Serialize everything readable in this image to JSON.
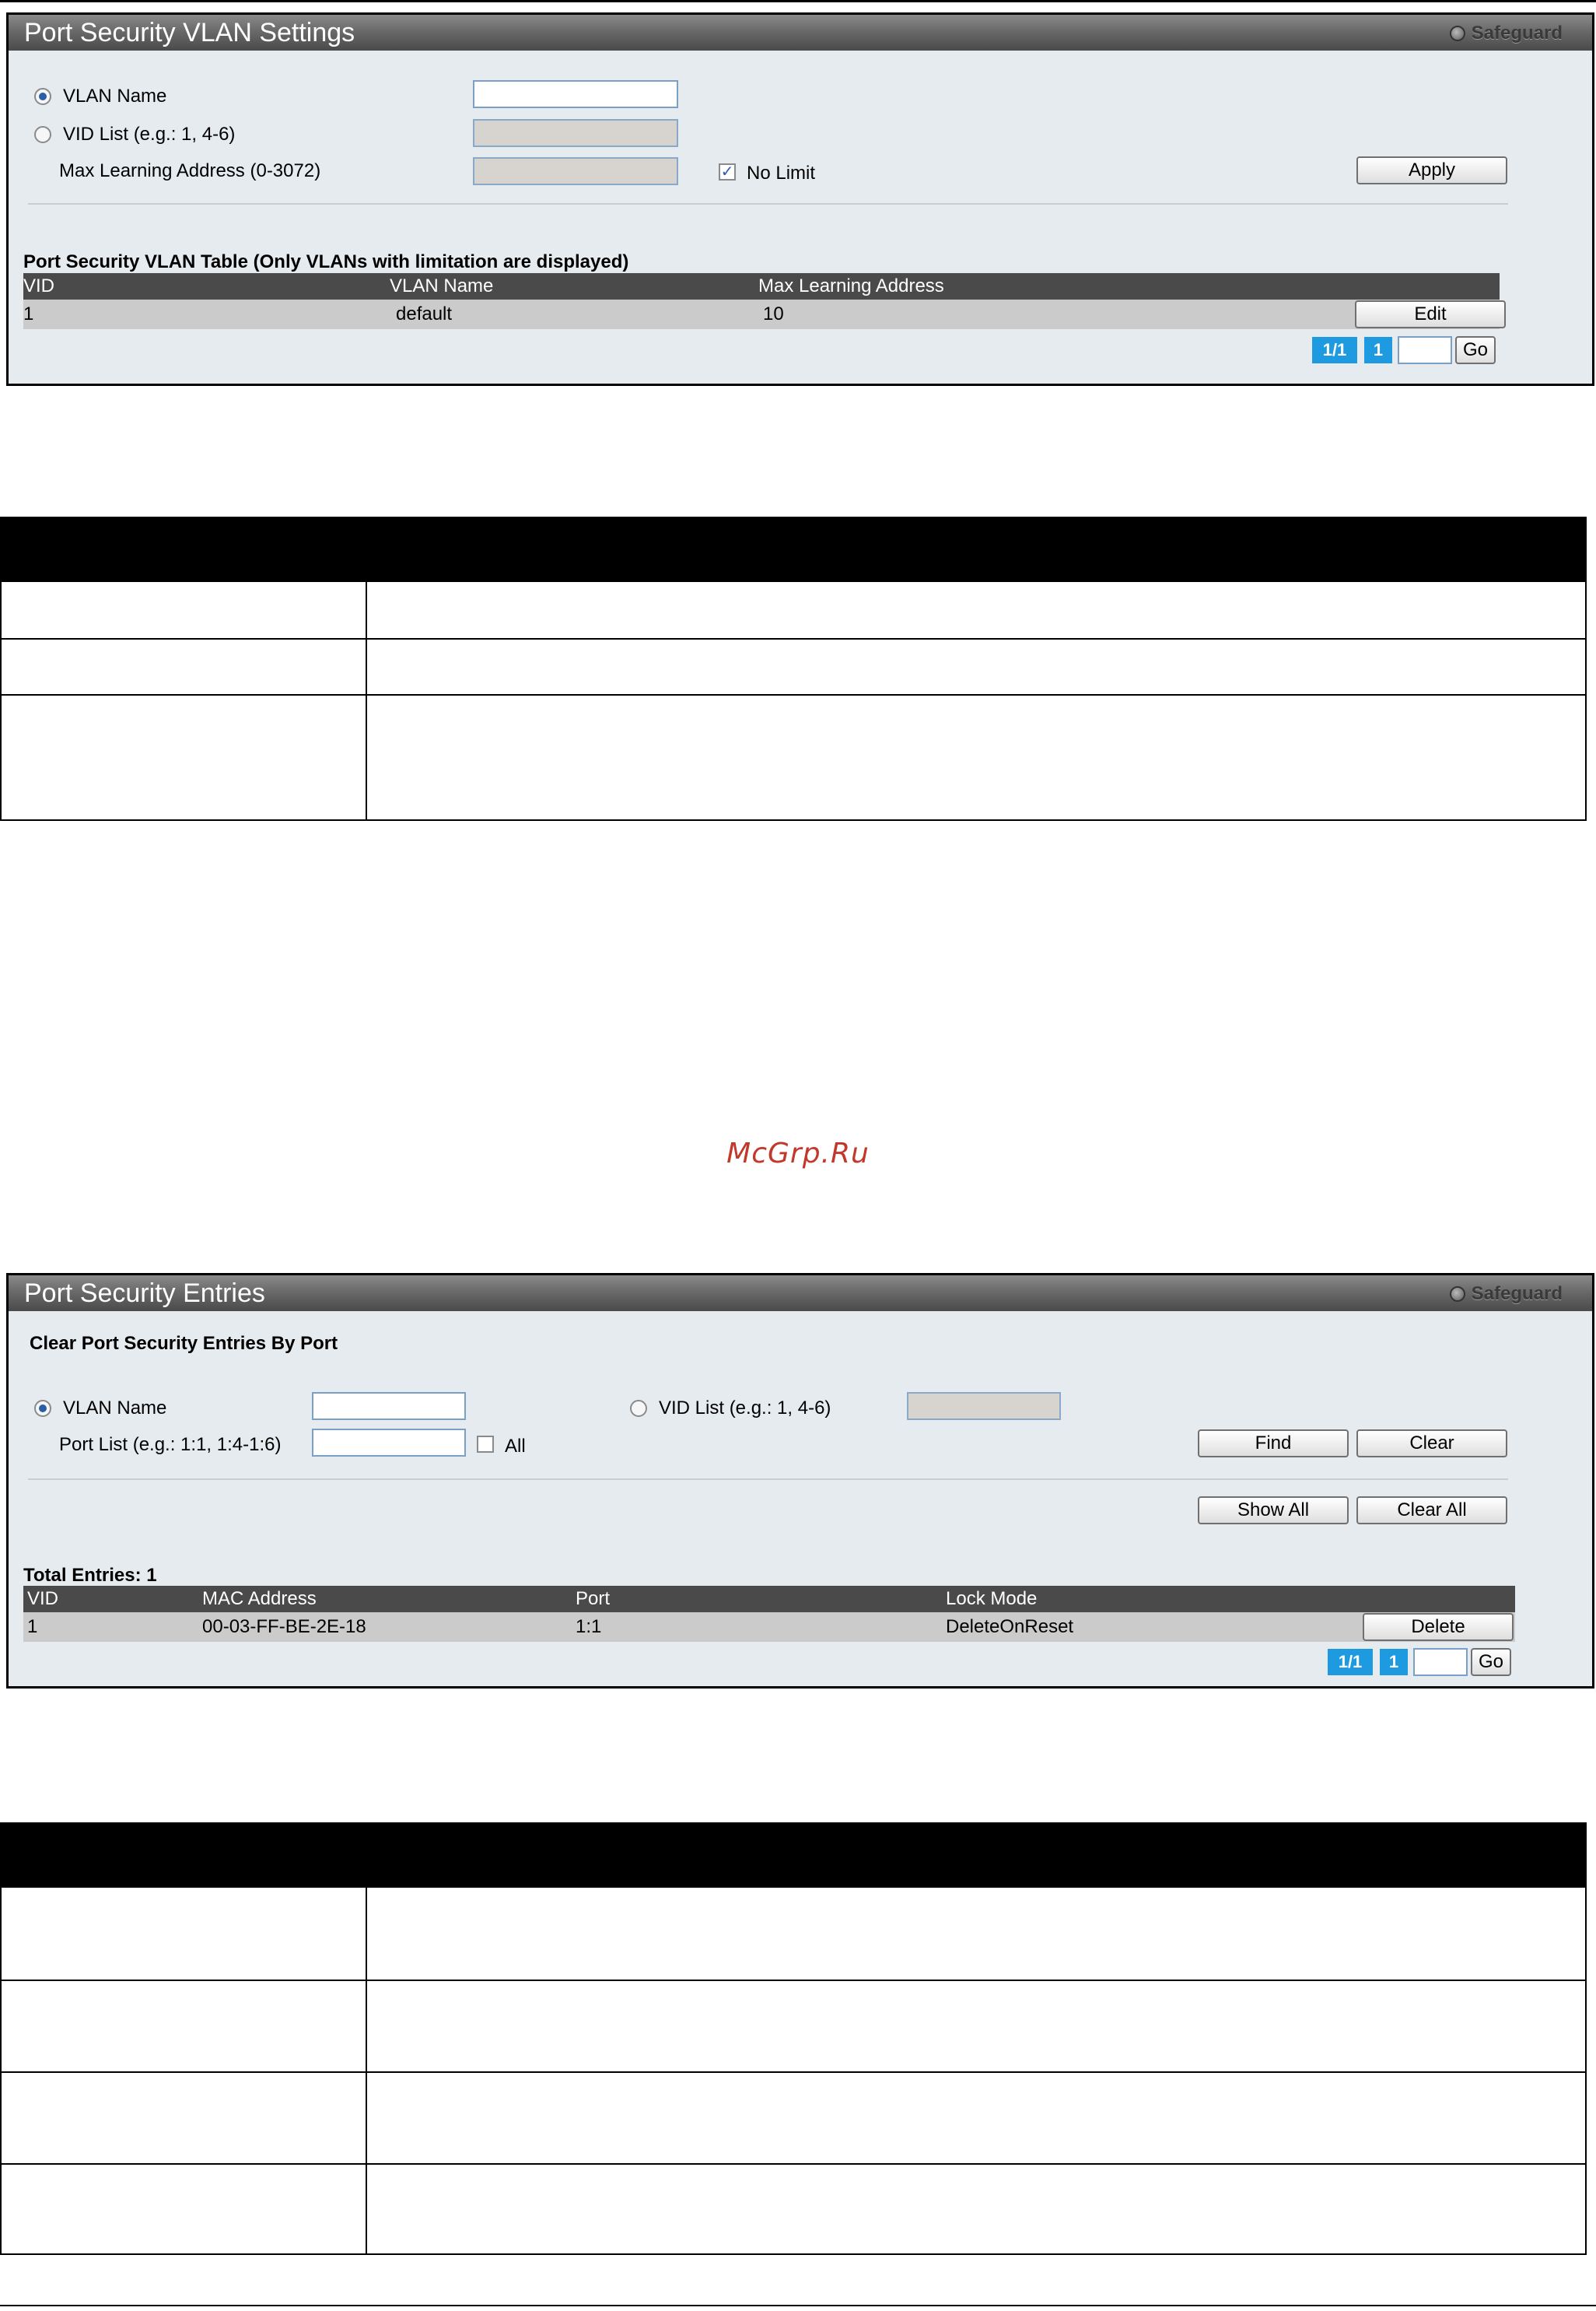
{
  "vlan_settings": {
    "title": "Port Security VLAN Settings",
    "safeguard": "Safeguard",
    "vlan_name_label": "VLAN Name",
    "vid_list_label": "VID List (e.g.: 1, 4-6)",
    "max_learning_label": "Max Learning Address (0-3072)",
    "no_limit_label": "No Limit",
    "no_limit_checked": true,
    "vlan_name_value": "",
    "apply_label": "Apply",
    "table_title": "Port Security VLAN Table (Only VLANs with limitation are displayed)",
    "columns": [
      "VID",
      "VLAN Name",
      "Max Learning Address"
    ],
    "rows": [
      {
        "vid": "1",
        "vlan_name": "default",
        "max_learning": "10",
        "action": "Edit"
      }
    ],
    "pager": {
      "pages": "1/1",
      "current": "1",
      "go_label": "Go"
    }
  },
  "watermark": "McGrp.Ru",
  "entries": {
    "title": "Port Security Entries",
    "safeguard": "Safeguard",
    "section_label": "Clear Port Security Entries By Port",
    "vlan_name_label": "VLAN Name",
    "vid_list_label": "VID List (e.g.: 1, 4-6)",
    "port_list_label": "Port List (e.g.: 1:1, 1:4-1:6)",
    "all_label": "All",
    "find_label": "Find",
    "clear_label": "Clear",
    "show_all_label": "Show All",
    "clear_all_label": "Clear All",
    "total_entries": "Total Entries: 1",
    "columns": [
      "VID",
      "MAC Address",
      "Port",
      "Lock Mode"
    ],
    "rows": [
      {
        "vid": "1",
        "mac": "00-03-FF-BE-2E-18",
        "port": "1:1",
        "lock_mode": "DeleteOnReset",
        "action": "Delete"
      }
    ],
    "pager": {
      "pages": "1/1",
      "current": "1",
      "go_label": "Go"
    }
  },
  "colors": {
    "panel_bg": "#e6ebef",
    "header_bg": "#5a5a5a",
    "row_bg": "#cbcbcb",
    "pager_blue": "#1e9ae0",
    "watermark_red": "#c0392b"
  }
}
